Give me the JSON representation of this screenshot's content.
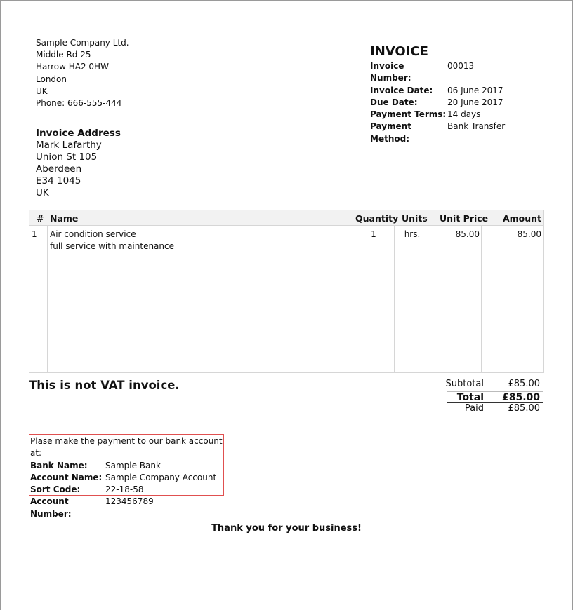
{
  "company": {
    "name": "Sample Company Ltd.",
    "street": "Middle Rd 25",
    "city_postcode": "Harrow HA2 0HW",
    "city": "London",
    "country": "UK",
    "phone": "Phone: 666-555-444"
  },
  "invoice": {
    "title": "INVOICE",
    "fields": [
      {
        "label": "Invoice Number:",
        "value": "00013"
      },
      {
        "label": "Invoice Date:",
        "value": "06 June 2017"
      },
      {
        "label": "Due Date:",
        "value": "20 June 2017"
      },
      {
        "label": "Payment Terms:",
        "value": "14 days"
      },
      {
        "label": "Payment Method:",
        "value": "Bank Transfer"
      }
    ]
  },
  "invoice_address": {
    "title": "Invoice Address",
    "name": "Mark Lafarthy",
    "street": "Union St 105",
    "city": "Aberdeen",
    "postcode": "E34 1045",
    "country": "UK"
  },
  "items_table": {
    "headers": {
      "index": "#",
      "name": "Name",
      "quantity": "Quantity",
      "units": "Units",
      "unit_price": "Unit Price",
      "amount": "Amount"
    },
    "rows": [
      {
        "index": "1",
        "name": "Air condition service",
        "description": "full service with maintenance",
        "quantity": "1",
        "units": "hrs.",
        "unit_price": "85.00",
        "amount": "85.00"
      }
    ]
  },
  "vat_note": "This is not VAT invoice.",
  "totals": {
    "subtotal_label": "Subtotal",
    "subtotal_value": "£85.00",
    "total_label": "Total",
    "total_value": "£85.00",
    "paid_label": "Paid",
    "paid_value": "£85.00"
  },
  "bank": {
    "intro": "Plase make the payment to our bank account at:",
    "fields": [
      {
        "label": "Bank Name:",
        "value": "Sample Bank"
      },
      {
        "label": "Account Name:",
        "value": "Sample Company Account"
      },
      {
        "label": "Sort Code:",
        "value": "22-18-58"
      },
      {
        "label": "Account Number:",
        "value": "123456789"
      }
    ],
    "border_color": "#e05050"
  },
  "thanks": "Thank you for your business!"
}
